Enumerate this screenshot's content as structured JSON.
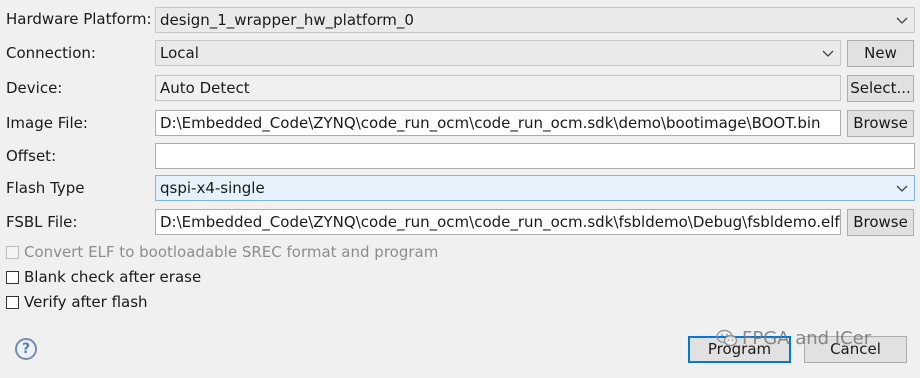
{
  "form": {
    "hardware_platform": {
      "label": "Hardware Platform:",
      "value": "design_1_wrapper_hw_platform_0"
    },
    "connection": {
      "label": "Connection:",
      "value": "Local",
      "new_button": "New"
    },
    "device": {
      "label": "Device:",
      "value": "Auto Detect",
      "select_button": "Select..."
    },
    "image_file": {
      "label": "Image File:",
      "value": "D:\\Embedded_Code\\ZYNQ\\code_run_ocm\\code_run_ocm.sdk\\demo\\bootimage\\BOOT.bin",
      "browse_button": "Browse"
    },
    "offset": {
      "label": "Offset:",
      "value": ""
    },
    "flash_type": {
      "label": "Flash Type",
      "value": "qspi-x4-single"
    },
    "fsbl_file": {
      "label": "FSBL File:",
      "value": "D:\\Embedded_Code\\ZYNQ\\code_run_ocm\\code_run_ocm.sdk\\fsbldemo\\Debug\\fsbldemo.elf",
      "browse_button": "Browse"
    }
  },
  "options": [
    {
      "label": "Convert ELF to bootloadable SREC format and program",
      "checked": false,
      "enabled": false
    },
    {
      "label": "Blank check after erase",
      "checked": false,
      "enabled": true
    },
    {
      "label": "Verify after flash",
      "checked": false,
      "enabled": true
    }
  ],
  "footer": {
    "help_glyph": "?",
    "program_button": "Program",
    "cancel_button": "Cancel",
    "watermark": "FPGA and ICer"
  },
  "icons": {
    "help": "help-icon",
    "dropdown": "chevron-down-icon",
    "watermark": "wechat-logo-icon"
  },
  "colors": {
    "background": "#f0f0f0",
    "highlight_field": "#e5f1fb",
    "default_button_border": "#0078d7"
  }
}
